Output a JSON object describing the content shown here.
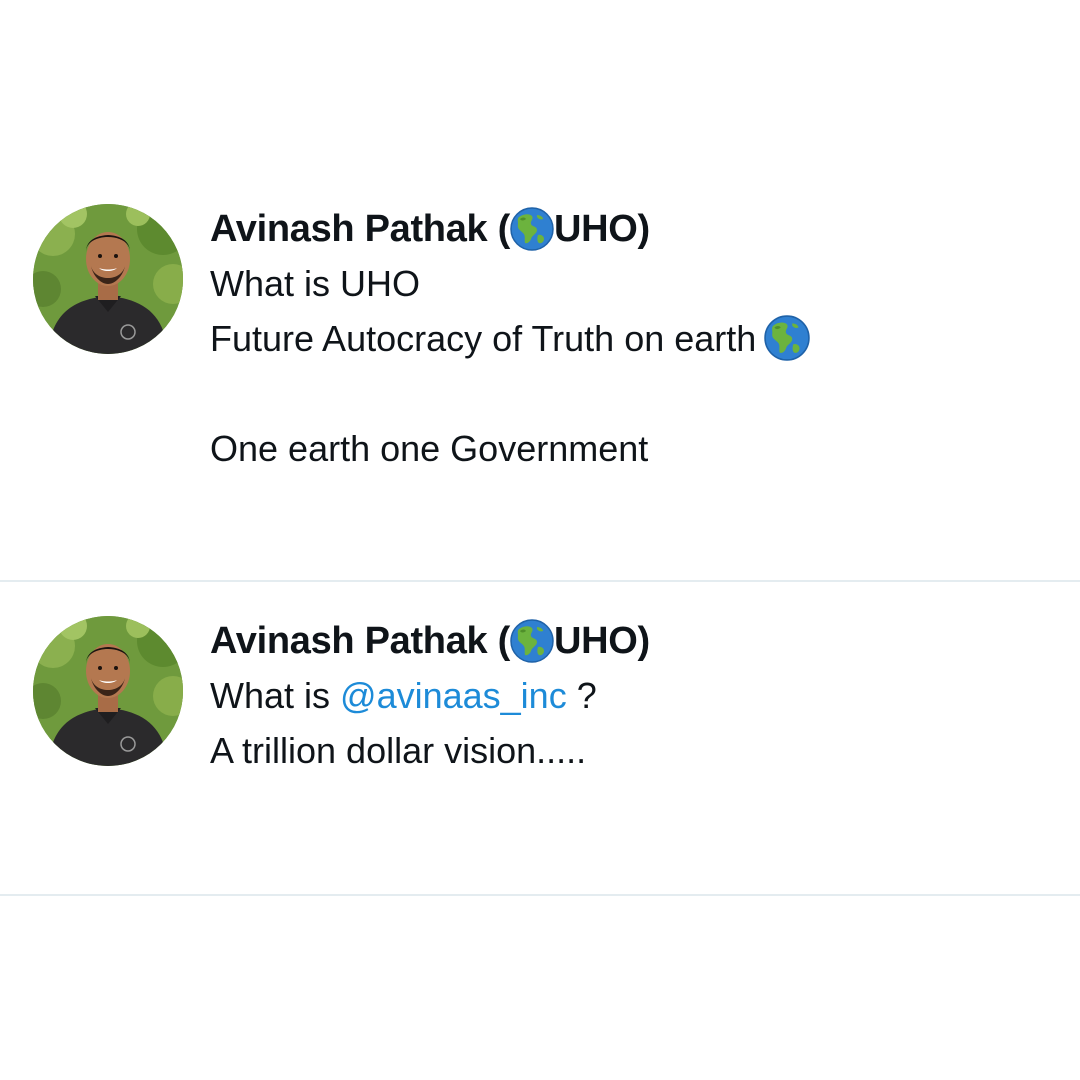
{
  "tweets": [
    {
      "author": {
        "name_prefix": "Avinash Pathak (",
        "name_suffix": "UHO)",
        "name_emoji": "globe-americas-icon"
      },
      "lines": [
        "What is UHO",
        "Future Autocracy of Truth on earth",
        "",
        "One earth one Government"
      ]
    },
    {
      "author": {
        "name_prefix": "Avinash Pathak (",
        "name_suffix": "UHO)",
        "name_emoji": "globe-americas-icon"
      },
      "line1_prefix": "What is ",
      "mention": "@avinaas_inc",
      "line1_suffix": " ?",
      "line2": "A trillion dollar vision....."
    }
  ],
  "colors": {
    "text": "#0f1419",
    "mention": "#1d8bd8",
    "divider": "#e4ecf0",
    "background": "#ffffff"
  }
}
